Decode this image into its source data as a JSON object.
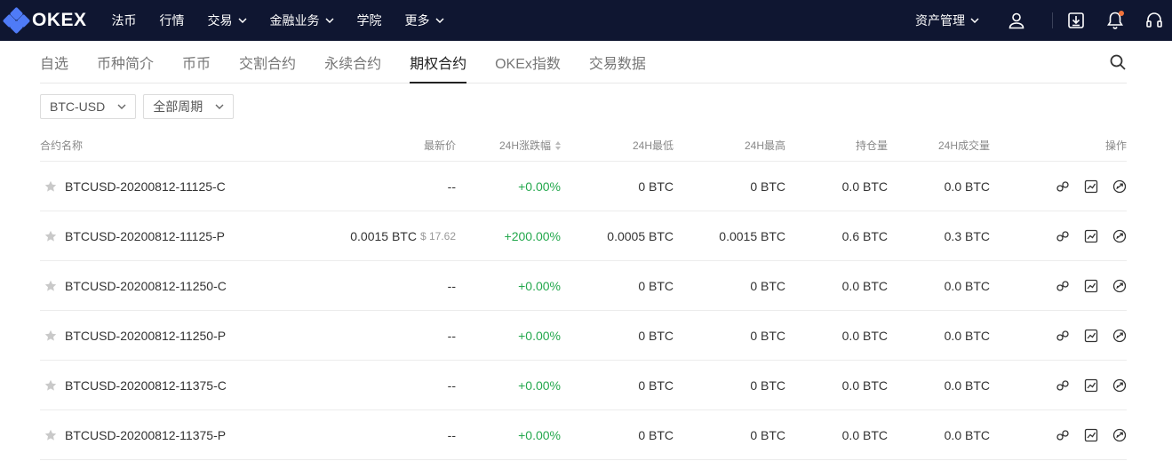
{
  "brand": {
    "name": "OKEX",
    "accent": "#4f7bf7",
    "nav_bg": "#0f1631"
  },
  "nav": {
    "items": [
      {
        "label": "法币",
        "dropdown": false
      },
      {
        "label": "行情",
        "dropdown": false
      },
      {
        "label": "交易",
        "dropdown": true
      },
      {
        "label": "金融业务",
        "dropdown": true
      },
      {
        "label": "学院",
        "dropdown": false
      },
      {
        "label": "更多",
        "dropdown": true
      }
    ],
    "assets_label": "资产管理",
    "icons": [
      "user-icon",
      "download-icon",
      "bell-icon",
      "headset-icon"
    ],
    "notification_dot_color": "#f2733b"
  },
  "subtabs": {
    "items": [
      "自选",
      "币种简介",
      "币币",
      "交割合约",
      "永续合约",
      "期权合约",
      "OKEx指数",
      "交易数据"
    ],
    "active": "期权合约"
  },
  "filters": {
    "underlying": "BTC-USD",
    "period": "全部周期"
  },
  "table": {
    "headers": {
      "name": "合约名称",
      "last": "最新价",
      "change": "24H涨跌幅",
      "low": "24H最低",
      "high": "24H最高",
      "oi": "持仓量",
      "volume": "24H成交量",
      "ops": "操作"
    },
    "rows": [
      {
        "name": "BTCUSD-20200812-11125-C",
        "last": "--",
        "last_usd": "",
        "change": "+0.00%",
        "low": "0 BTC",
        "high": "0 BTC",
        "oi": "0.0 BTC",
        "volume": "0.0 BTC"
      },
      {
        "name": "BTCUSD-20200812-11125-P",
        "last": "0.0015 BTC",
        "last_usd": "$ 17.62",
        "change": "+200.00%",
        "low": "0.0005 BTC",
        "high": "0.0015 BTC",
        "oi": "0.6 BTC",
        "volume": "0.3 BTC"
      },
      {
        "name": "BTCUSD-20200812-11250-C",
        "last": "--",
        "last_usd": "",
        "change": "+0.00%",
        "low": "0 BTC",
        "high": "0 BTC",
        "oi": "0.0 BTC",
        "volume": "0.0 BTC"
      },
      {
        "name": "BTCUSD-20200812-11250-P",
        "last": "--",
        "last_usd": "",
        "change": "+0.00%",
        "low": "0 BTC",
        "high": "0 BTC",
        "oi": "0.0 BTC",
        "volume": "0.0 BTC"
      },
      {
        "name": "BTCUSD-20200812-11375-C",
        "last": "--",
        "last_usd": "",
        "change": "+0.00%",
        "low": "0 BTC",
        "high": "0 BTC",
        "oi": "0.0 BTC",
        "volume": "0.0 BTC"
      },
      {
        "name": "BTCUSD-20200812-11375-P",
        "last": "--",
        "last_usd": "",
        "change": "+0.00%",
        "low": "0 BTC",
        "high": "0 BTC",
        "oi": "0.0 BTC",
        "volume": "0.0 BTC"
      }
    ],
    "row_actions": [
      "compare-icon",
      "chart-icon",
      "trade-icon"
    ],
    "positive_color": "#24a84d"
  }
}
